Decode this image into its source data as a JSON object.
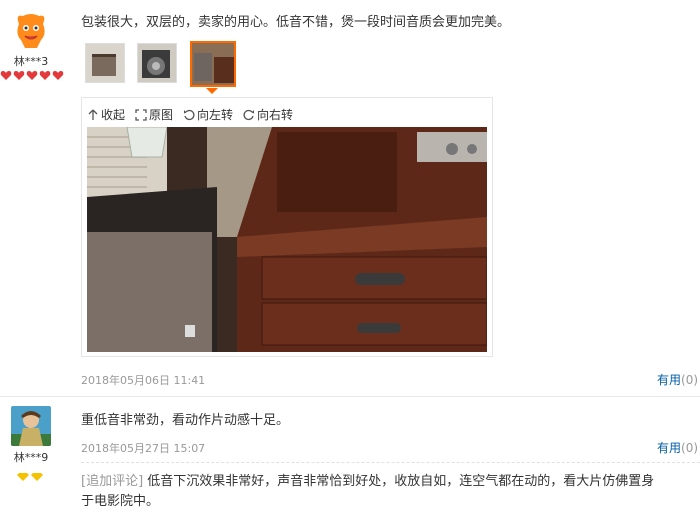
{
  "colors": {
    "link": "#005ea7",
    "muted": "#999999",
    "accent": "#ff6a00"
  },
  "review1": {
    "user": "林***3",
    "text": "包装很大，双层的，卖家的用心。低音不错，煲一段时间音质会更加完美。",
    "date": "2018年05月06日 11:41",
    "helpful": "有用",
    "helpful_count": "(0)",
    "level_icon": "heart-badges",
    "viewer": {
      "collapse": "收起",
      "original": "原图",
      "rotate_left": "向左转",
      "rotate_right": "向右转"
    }
  },
  "review2": {
    "user": "林***9",
    "text": "重低音非常劲，看动作片动感十足。",
    "date": "2018年05月27日 15:07",
    "helpful": "有用",
    "helpful_count": "(0)",
    "level_icon": "diamond-badges",
    "followup_tag": "[追加评论]",
    "followup_text": "低音下沉效果非常好，声音非常恰到好处，收放自如，连空气都在动的，看大片仿佛置身",
    "followup_text2": "于电影院中。"
  }
}
